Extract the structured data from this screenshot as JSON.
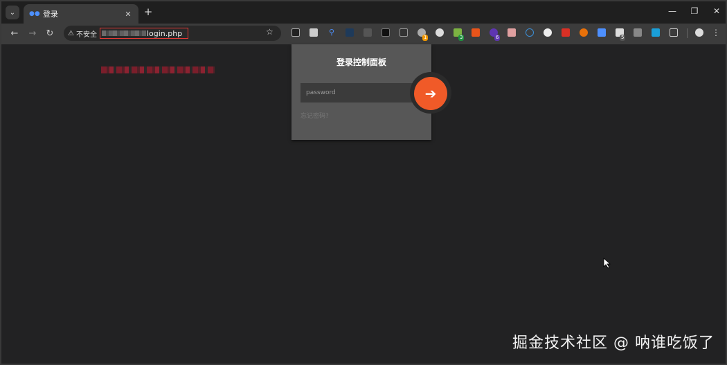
{
  "browser": {
    "tab": {
      "title": "登录",
      "close_icon": "close-icon"
    },
    "address": {
      "security_label": "不安全",
      "url_visible": "login.php"
    },
    "extension_badges": [
      "1",
      "3",
      "6",
      "5"
    ]
  },
  "panel": {
    "title": "登录控制面板",
    "password_placeholder": "password",
    "forgot_text": "忘记密码?",
    "submit_icon": "arrow-right-icon"
  },
  "watermark": "掘金技术社区 @ 呐谁吃饭了",
  "colors": {
    "accent": "#f05a28",
    "background": "#222223",
    "panel": "#575757"
  }
}
